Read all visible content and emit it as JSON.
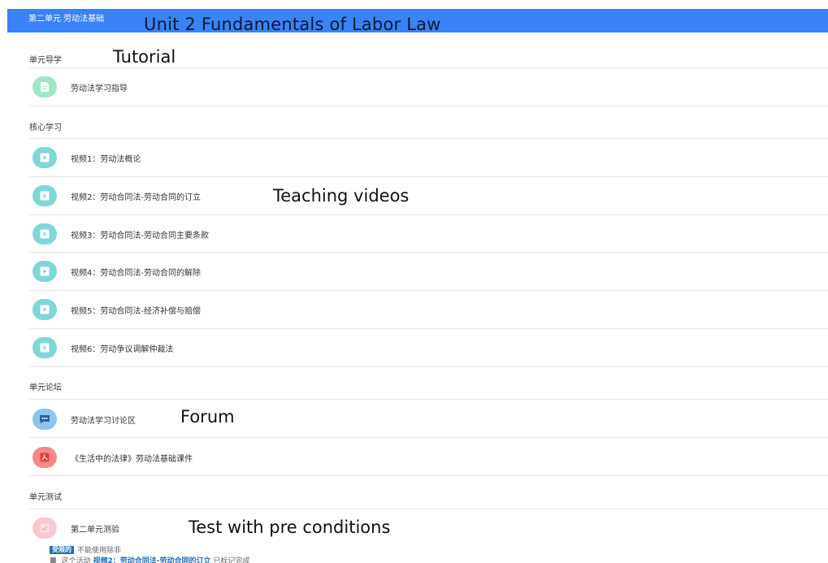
{
  "header": {
    "title": "第二单元 劳动法基础",
    "annotation": "Unit 2 Fundamentals of Labor Law",
    "color": "#3a82f7"
  },
  "sections": {
    "guide": {
      "title": "单元导学",
      "annotation": "Tutorial",
      "items": [
        {
          "label": "劳动法学习指导",
          "icon": "file-icon"
        }
      ]
    },
    "core": {
      "title": "核心学习",
      "annotation": "Teaching videos",
      "items": [
        {
          "label": "视频1：劳动法概论",
          "icon": "video-icon"
        },
        {
          "label": "视频2：劳动合同法-劳动合同的订立",
          "icon": "video-icon"
        },
        {
          "label": "视频3：劳动合同法-劳动合同主要条款",
          "icon": "video-icon"
        },
        {
          "label": "视频4：劳动合同法-劳动合同的解除",
          "icon": "video-icon"
        },
        {
          "label": "视频5：劳动合同法-经济补偿与赔偿",
          "icon": "video-icon"
        },
        {
          "label": "视频6：劳动争议调解仲裁法",
          "icon": "video-icon"
        }
      ]
    },
    "forum": {
      "title": "单元论坛",
      "annotation": "Forum",
      "items": [
        {
          "label": "劳动法学习讨论区",
          "icon": "forum-icon"
        },
        {
          "label": "《生活中的法律》劳动法基础课件",
          "icon": "pdf-icon"
        }
      ]
    },
    "test": {
      "title": "单元测试",
      "annotation": "Test with pre conditions",
      "items": [
        {
          "label": "第二单元测验",
          "icon": "quiz-icon"
        }
      ],
      "restriction": {
        "badge": "受限的",
        "text": "不能使用除非",
        "condition_prefix": "这个活动",
        "condition_link": "视频2：劳动合同法-劳动合同的订立",
        "condition_suffix": "已标记完成"
      }
    }
  }
}
